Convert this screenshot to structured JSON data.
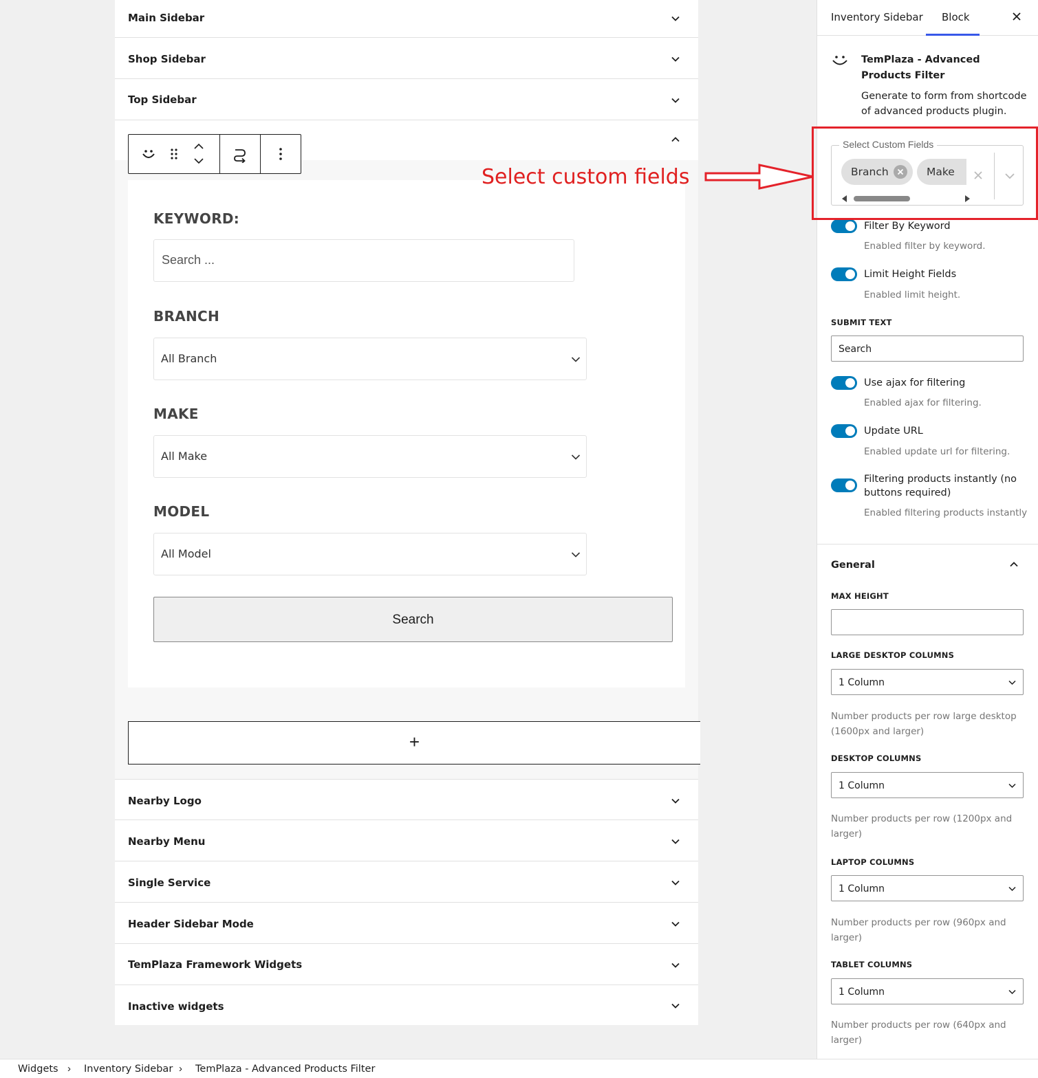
{
  "widget_areas_top": [
    {
      "label": "Main Sidebar"
    },
    {
      "label": "Shop Sidebar"
    },
    {
      "label": "Top Sidebar"
    }
  ],
  "widget_areas_bottom": [
    {
      "label": "Nearby Logo"
    },
    {
      "label": "Nearby Menu"
    },
    {
      "label": "Single Service"
    },
    {
      "label": "Header Sidebar Mode"
    },
    {
      "label": "TemPlaza Framework Widgets"
    },
    {
      "label": "Inactive widgets"
    }
  ],
  "block_toolbar": {
    "icons": [
      "templaza-block-icon",
      "drag-handle-icon",
      "move-up-icon",
      "move-down-icon",
      "transform-icon",
      "more-options-icon"
    ]
  },
  "filter_form": {
    "keyword_label": "KEYWORD:",
    "keyword_placeholder": "Search ...",
    "branch_label": "BRANCH",
    "branch_value": "All Branch",
    "make_label": "MAKE",
    "make_value": "All Make",
    "model_label": "MODEL",
    "model_value": "All Model",
    "submit_label": "Search",
    "add_block_label": "+"
  },
  "annotation": {
    "text": "Select custom fields",
    "color": "#e02020"
  },
  "inspector": {
    "tabs": [
      {
        "label": "Inventory Sidebar"
      },
      {
        "label": "Block",
        "active": true
      }
    ],
    "block_card": {
      "title": "TemPlaza - Advanced Products Filter",
      "description": "Generate to form from shortcode of advanced products plugin."
    },
    "custom_fields": {
      "legend": "Select Custom Fields",
      "chips": [
        "Branch",
        "Make"
      ]
    },
    "toggles": [
      {
        "label": "Filter By Keyword",
        "help": "Enabled filter by keyword.",
        "on": true
      },
      {
        "label": "Limit Height Fields",
        "help": "Enabled limit height.",
        "on": true
      },
      {
        "label": "Use ajax for filtering",
        "help": "Enabled ajax for filtering.",
        "on": true
      },
      {
        "label": "Update URL",
        "help": "Enabled update url for filtering.",
        "on": true
      },
      {
        "label": "Filtering products instantly (no buttons required)",
        "help": "Enabled filtering products instantly",
        "on": true
      }
    ],
    "submit_text": {
      "label": "SUBMIT TEXT",
      "value": "Search"
    },
    "general": {
      "title": "General",
      "max_height": {
        "label": "MAX HEIGHT",
        "value": ""
      },
      "large_desktop": {
        "label": "LARGE DESKTOP COLUMNS",
        "value": "1 Column",
        "help": "Number products per row large desktop (1600px and larger)"
      },
      "desktop": {
        "label": "DESKTOP COLUMNS",
        "value": "1 Column",
        "help": "Number products per row (1200px and larger)"
      },
      "laptop": {
        "label": "LAPTOP COLUMNS",
        "value": "1 Column",
        "help": "Number products per row (960px and larger)"
      },
      "tablet": {
        "label": "TABLET COLUMNS",
        "value": "1 Column",
        "help": "Number products per row (640px and larger)"
      }
    }
  },
  "breadcrumb": [
    "Widgets",
    "Inventory Sidebar",
    "TemPlaza - Advanced Products Filter"
  ],
  "colors": {
    "accent": "#007cba",
    "tab_underline": "#3858e9",
    "highlight_box": "#e4222a"
  }
}
